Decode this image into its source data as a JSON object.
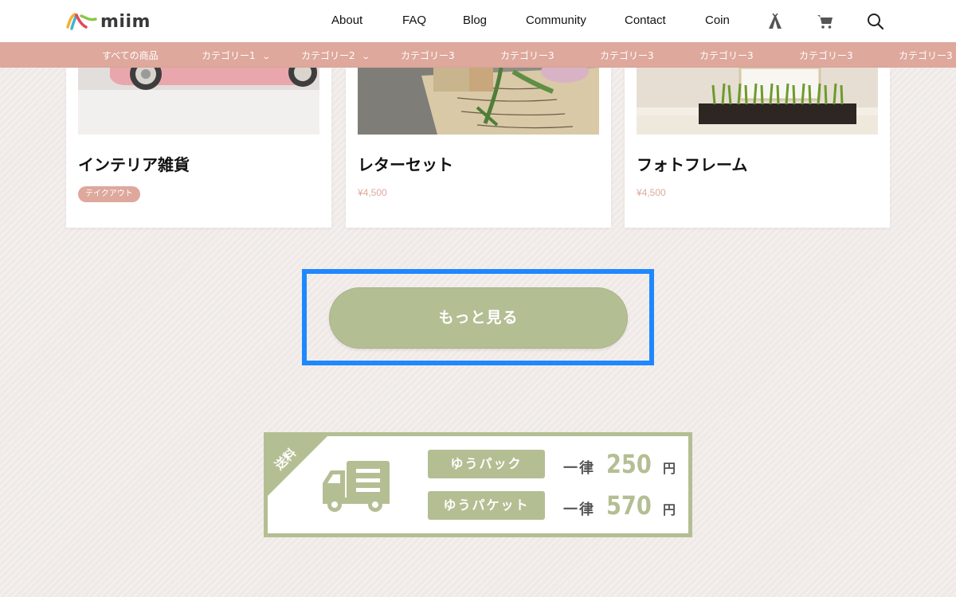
{
  "header": {
    "logo_text": "miim",
    "nav": [
      "About",
      "FAQ",
      "Blog",
      "Community",
      "Contact",
      "Coin"
    ],
    "icons": [
      "tent-icon",
      "cart-icon",
      "search-icon"
    ]
  },
  "category_bar": {
    "items": [
      {
        "label": "すべての商品",
        "has_dropdown": false
      },
      {
        "label": "カテゴリー1",
        "has_dropdown": true
      },
      {
        "label": "カテゴリー2",
        "has_dropdown": true
      },
      {
        "label": "カテゴリー3",
        "has_dropdown": false
      },
      {
        "label": "カテゴリー3",
        "has_dropdown": false
      },
      {
        "label": "カテゴリー3",
        "has_dropdown": false
      },
      {
        "label": "カテゴリー3",
        "has_dropdown": false
      },
      {
        "label": "カテゴリー3",
        "has_dropdown": false
      },
      {
        "label": "カテゴリー3",
        "has_dropdown": false
      }
    ]
  },
  "products": [
    {
      "title": "インテリア雑貨",
      "tag": "テイクアウト",
      "price": "",
      "image": "car-photo"
    },
    {
      "title": "レターセット",
      "tag": "",
      "price": "¥4,500",
      "image": "letter-flower-photo"
    },
    {
      "title": "フォトフレーム",
      "tag": "",
      "price": "¥4,500",
      "image": "grass-planter-photo"
    }
  ],
  "more_button": {
    "label": "もっと見る"
  },
  "shipping": {
    "corner_label": "送料",
    "methods": [
      {
        "name": "ゆうパック",
        "flat": "一律",
        "price": "250",
        "unit": "円"
      },
      {
        "name": "ゆうパケット",
        "flat": "一律",
        "price": "570",
        "unit": "円"
      }
    ]
  },
  "colors": {
    "accent_pink": "#dea89c",
    "accent_green": "#b4be93",
    "highlight_blue": "#1e88ff",
    "background": "#efe9e7"
  }
}
